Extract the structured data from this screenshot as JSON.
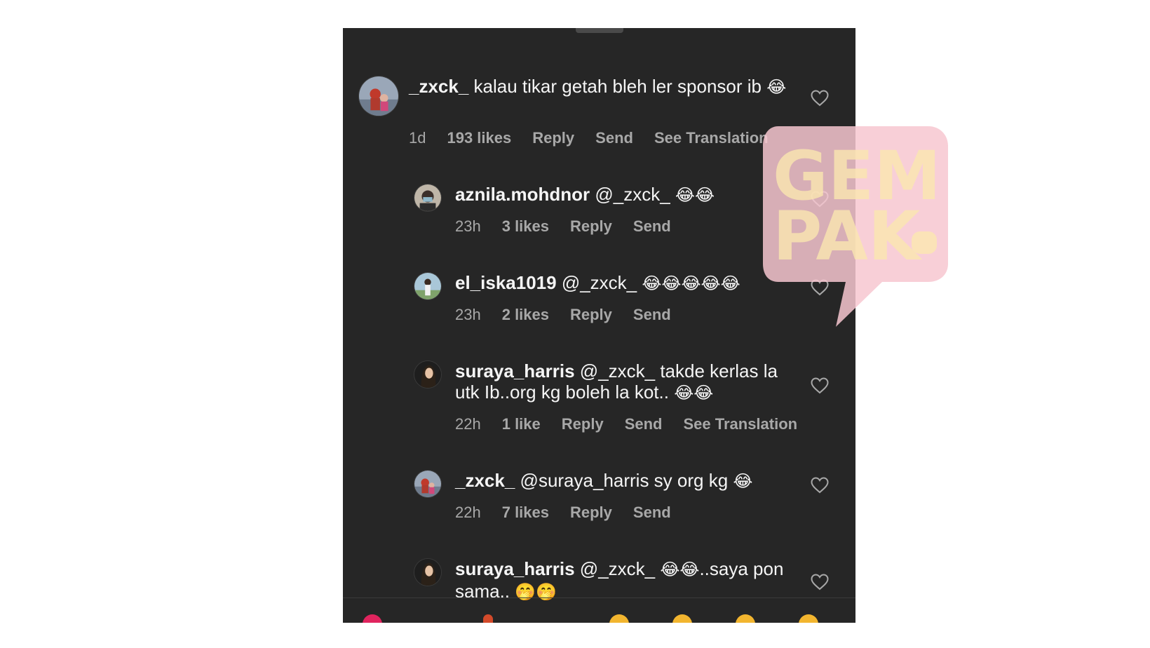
{
  "comments": [
    {
      "username": "_zxck_",
      "text": "kalau tikar getah bleh ler sponsor ib",
      "emoji": "😂",
      "time": "1d",
      "likes": "193 likes",
      "reply": "Reply",
      "send": "Send",
      "translate": "See Translation"
    },
    {
      "username": "aznila.mohdnor",
      "text": "@_zxck_",
      "emoji": "😂😂",
      "time": "23h",
      "likes": "3 likes",
      "reply": "Reply",
      "send": "Send"
    },
    {
      "username": "el_iska1019",
      "text": "@_zxck_",
      "emoji": "😂😂😂😂😂",
      "time": "23h",
      "likes": "2 likes",
      "reply": "Reply",
      "send": "Send"
    },
    {
      "username": "suraya_harris",
      "text": "@_zxck_ takde kerlas la utk Ib..org kg boleh la kot..",
      "emoji": "😂😂",
      "time": "22h",
      "likes": "1 like",
      "reply": "Reply",
      "send": "Send",
      "translate": "See Translation"
    },
    {
      "username": "_zxck_",
      "text": "@suraya_harris sy org kg",
      "emoji": "😂",
      "time": "22h",
      "likes": "7 likes",
      "reply": "Reply",
      "send": "Send"
    },
    {
      "username": "suraya_harris",
      "text": "@_zxck_",
      "emoji": "😂😂",
      "text2": "..saya pon sama..",
      "emoji2": "🤭🤭"
    }
  ],
  "watermark": {
    "line1": "GEM",
    "line2": "PAK",
    "color_bubble": "#f7c7d0",
    "color_text": "#fbe7b0"
  },
  "icons": {
    "heart": "heart-outline-icon",
    "avatar": "user-avatar"
  },
  "colors": {
    "panel_bg": "#262626",
    "text_primary": "#f5f5f5",
    "text_secondary": "#a8a8a8"
  }
}
